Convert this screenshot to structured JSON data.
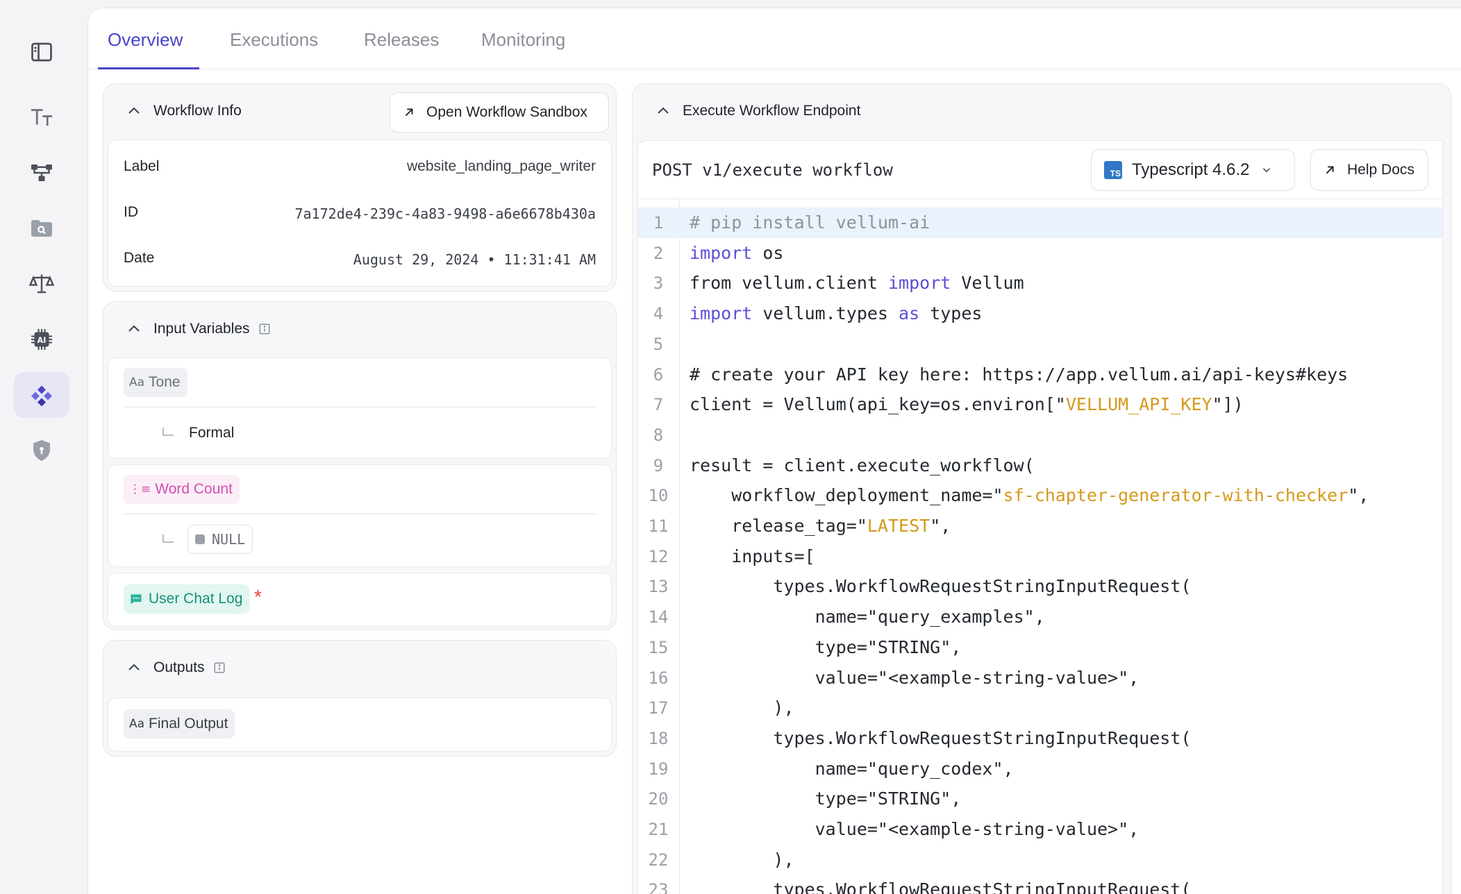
{
  "tabs": [
    {
      "label": "Overview",
      "active": true
    },
    {
      "label": "Executions",
      "active": false
    },
    {
      "label": "Releases",
      "active": false
    },
    {
      "label": "Monitoring",
      "active": false
    }
  ],
  "rail": {
    "icons": [
      "sidebar-toggle-icon",
      "text-format-icon",
      "workflow-tree-icon",
      "folder-search-icon",
      "scale-icon",
      "ai-chip-icon",
      "deployment-diamonds-icon",
      "shield-icon"
    ],
    "active_index": 6
  },
  "workflow_info": {
    "title": "Workflow Info",
    "open_sandbox_label": "Open Workflow Sandbox",
    "rows": [
      {
        "label": "Label",
        "value": "website_landing_page_writer"
      },
      {
        "label": "ID",
        "value": "7a172de4-239c-4a83-9498-a6e6678b430a"
      },
      {
        "label": "Date",
        "value": "August 29, 2024 • 11:31:41 AM"
      }
    ]
  },
  "input_variables": {
    "title": "Input Variables",
    "items": [
      {
        "name": "Tone",
        "type_glyph": "Aa",
        "value": "Formal",
        "color": "#6b7079",
        "bg": "#eef0f3"
      },
      {
        "name": "Word Count",
        "type_glyph": "⋮≡",
        "value": "NULL",
        "color": "#d24fb0",
        "bg": "#fbeef7"
      },
      {
        "name": "User Chat Log",
        "type_glyph": "▬",
        "required_mark": "*",
        "color": "#15917b",
        "bg": "#e2f5f0"
      }
    ]
  },
  "outputs": {
    "title": "Outputs",
    "items": [
      {
        "name": "Final Output",
        "type_glyph": "Aa"
      }
    ]
  },
  "endpoint_panel": {
    "title": "Execute Workflow Endpoint",
    "endpoint": "POST v1/execute workflow",
    "language": "Typescript 4.6.2",
    "language_badge": "TS",
    "help_docs_label": "Help Docs",
    "highlighted_line": 1,
    "lines": [
      [
        {
          "t": "# pip install vellum-ai",
          "c": "comment"
        }
      ],
      [
        {
          "t": "import",
          "c": "kw"
        },
        {
          "t": " os",
          "c": ""
        }
      ],
      [
        {
          "t": "from vellum.client ",
          "c": ""
        },
        {
          "t": "import",
          "c": "kw"
        },
        {
          "t": " Vellum",
          "c": ""
        }
      ],
      [
        {
          "t": "import",
          "c": "kw"
        },
        {
          "t": " vellum.types ",
          "c": ""
        },
        {
          "t": "as",
          "c": "kw"
        },
        {
          "t": " types",
          "c": ""
        }
      ],
      [],
      [
        {
          "t": "# create your API key here: https://app.vellum.ai/api-keys#keys",
          "c": ""
        }
      ],
      [
        {
          "t": "client = Vellum(api_key=os.environ[\"",
          "c": ""
        },
        {
          "t": "VELLUM_API_KEY",
          "c": "str"
        },
        {
          "t": "\"])",
          "c": ""
        }
      ],
      [],
      [
        {
          "t": "result = client.execute_workflow(",
          "c": ""
        }
      ],
      [
        {
          "t": "    workflow_deployment_name=\"",
          "c": ""
        },
        {
          "t": "sf-chapter-generator-with-checker",
          "c": "str"
        },
        {
          "t": "\",",
          "c": ""
        }
      ],
      [
        {
          "t": "    release_tag=\"",
          "c": ""
        },
        {
          "t": "LATEST",
          "c": "str"
        },
        {
          "t": "\",",
          "c": ""
        }
      ],
      [
        {
          "t": "    inputs=[",
          "c": ""
        }
      ],
      [
        {
          "t": "        types.WorkflowRequestStringInputRequest(",
          "c": ""
        }
      ],
      [
        {
          "t": "            name=\"query_examples\",",
          "c": ""
        }
      ],
      [
        {
          "t": "            type=\"STRING\",",
          "c": ""
        }
      ],
      [
        {
          "t": "            value=\"<example-string-value>\",",
          "c": ""
        }
      ],
      [
        {
          "t": "        ),",
          "c": ""
        }
      ],
      [
        {
          "t": "        types.WorkflowRequestStringInputRequest(",
          "c": ""
        }
      ],
      [
        {
          "t": "            name=\"query_codex\",",
          "c": ""
        }
      ],
      [
        {
          "t": "            type=\"STRING\",",
          "c": ""
        }
      ],
      [
        {
          "t": "            value=\"<example-string-value>\",",
          "c": ""
        }
      ],
      [
        {
          "t": "        ),",
          "c": ""
        }
      ],
      [
        {
          "t": "        types.WorkflowRequestStringInputRequest(",
          "c": ""
        }
      ]
    ]
  },
  "colors": {
    "accent": "#4a44c9",
    "string": "#d49a1b",
    "keyword": "#5b4fd6",
    "required": "#e0463c"
  }
}
